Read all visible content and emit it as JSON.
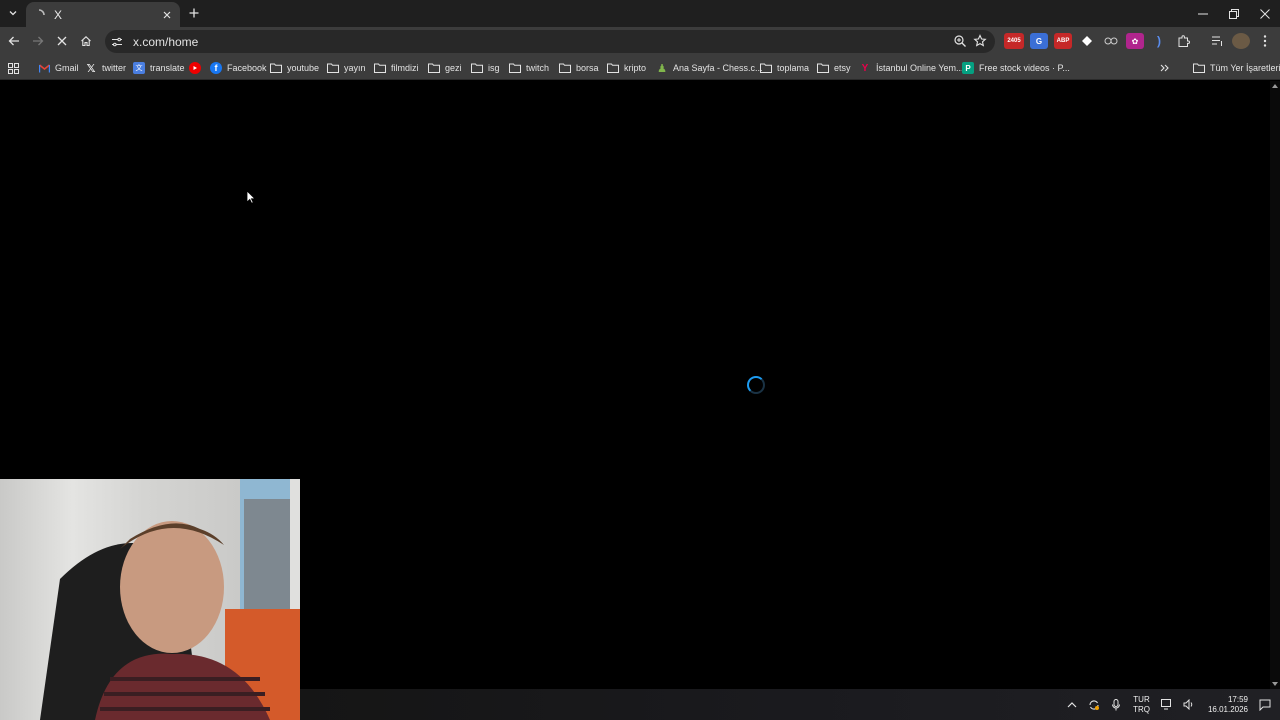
{
  "browser": {
    "tab": {
      "title": "X"
    },
    "address": {
      "url": "x.com/home"
    },
    "bookmarks": [
      {
        "label": "Gmail",
        "icon": "gmail-icon"
      },
      {
        "label": "twitter",
        "icon": "x-icon"
      },
      {
        "label": "translate",
        "icon": "translate-icon"
      },
      {
        "label": "",
        "icon": "youtube-icon"
      },
      {
        "label": "Facebook",
        "icon": "facebook-icon"
      },
      {
        "label": "youtube",
        "icon": "folder-icon"
      },
      {
        "label": "yayın",
        "icon": "folder-icon"
      },
      {
        "label": "filmdizi",
        "icon": "folder-icon"
      },
      {
        "label": "gezi",
        "icon": "folder-icon"
      },
      {
        "label": "isg",
        "icon": "folder-icon"
      },
      {
        "label": "twitch",
        "icon": "folder-icon"
      },
      {
        "label": "borsa",
        "icon": "folder-icon"
      },
      {
        "label": "kripto",
        "icon": "folder-icon"
      },
      {
        "label": "Ana Sayfa - Chess.c...",
        "icon": "chess-icon"
      },
      {
        "label": "toplama",
        "icon": "folder-icon"
      },
      {
        "label": "etsy",
        "icon": "folder-icon"
      },
      {
        "label": "İstanbul Online Yem...",
        "icon": "yemeksepeti-icon"
      },
      {
        "label": "Free stock videos · P...",
        "icon": "pexels-icon"
      }
    ],
    "all_bookmarks": "Tüm Yer İşaretleri",
    "extension_badge": "2405"
  },
  "taskbar": {
    "lang_top": "TUR",
    "lang_bottom": "TRQ",
    "time": "17:59",
    "date": "16.01.2026"
  },
  "colors": {
    "accent": "#1d9bf0",
    "chrome_bg": "#3c3c3c",
    "tab_strip": "#1f1f1f"
  }
}
